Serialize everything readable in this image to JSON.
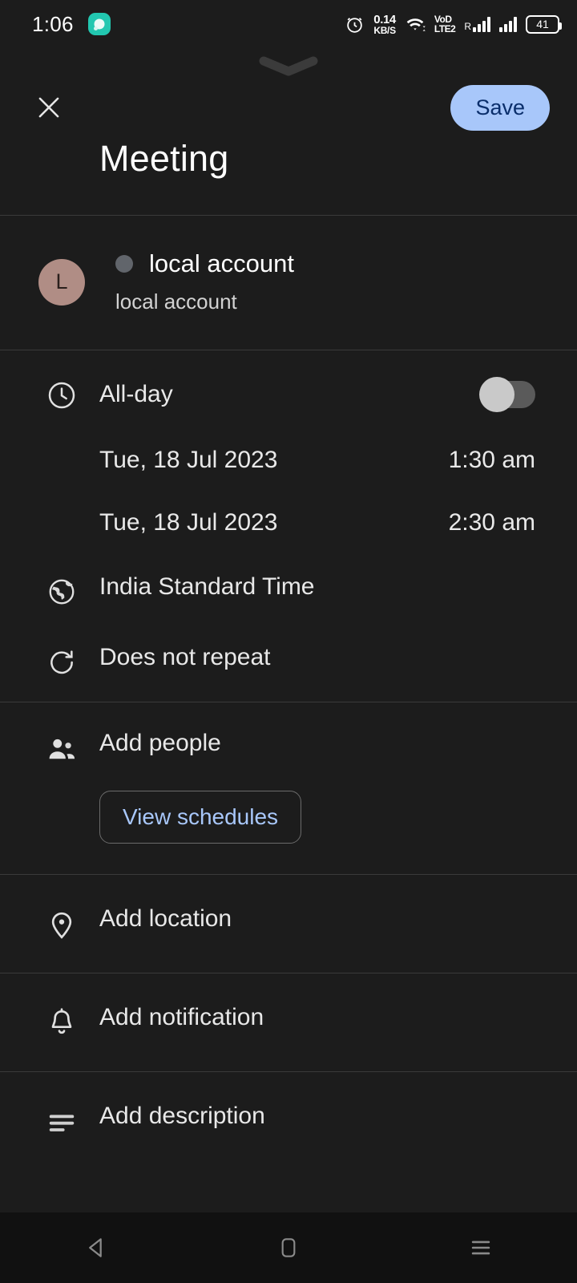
{
  "status_bar": {
    "time": "1:06",
    "app_icon": "music-app-icon",
    "alarm_icon": "alarm-clock-icon",
    "data_rate_value": "0.14",
    "data_rate_unit": "KB/S",
    "wifi_icon": "wifi-icon",
    "volte_line1": "VoD",
    "volte_line2": "LTE2",
    "roaming_label": "R",
    "signal_icon_1": "signal-bars-roaming-icon",
    "signal_icon_2": "signal-bars-icon",
    "battery_level": "41",
    "battery_icon": "battery-icon"
  },
  "app_bar": {
    "drag_handle_icon": "chevron-down-icon",
    "close_icon": "close-icon",
    "save_label": "Save"
  },
  "event": {
    "title": "Meeting"
  },
  "account": {
    "avatar_letter": "L",
    "avatar_color": "#b08d85",
    "calendar_color": "#61656b",
    "name": "local account",
    "subtitle": "local account"
  },
  "time_section": {
    "clock_icon": "clock-icon",
    "all_day_label": "All-day",
    "all_day_enabled": false,
    "start_date": "Tue, 18 Jul 2023",
    "start_time": "1:30 am",
    "end_date": "Tue, 18 Jul 2023",
    "end_time": "2:30 am",
    "timezone_icon": "globe-icon",
    "timezone": "India Standard Time",
    "repeat_icon": "repeat-icon",
    "repeat": "Does not repeat"
  },
  "people_section": {
    "people_icon": "people-icon",
    "add_people_label": "Add people",
    "view_schedules_label": "View schedules"
  },
  "location_section": {
    "location_icon": "location-pin-icon",
    "add_location_label": "Add location"
  },
  "notification_section": {
    "bell_icon": "bell-icon",
    "add_notification_label": "Add notification"
  },
  "description_section": {
    "description_icon": "description-lines-icon",
    "add_description_label": "Add description"
  },
  "nav_bar": {
    "back_icon": "back-triangle-icon",
    "home_icon": "home-square-icon",
    "recents_icon": "recents-lines-icon"
  },
  "colors": {
    "background": "#1c1c1c",
    "accent_blue": "#a8c7fa",
    "save_text": "#0a2e6b",
    "divider": "#3a3a3a",
    "text_primary": "#ffffff",
    "text_secondary": "#d2d2d2",
    "nav_bar_bg": "#111111"
  }
}
